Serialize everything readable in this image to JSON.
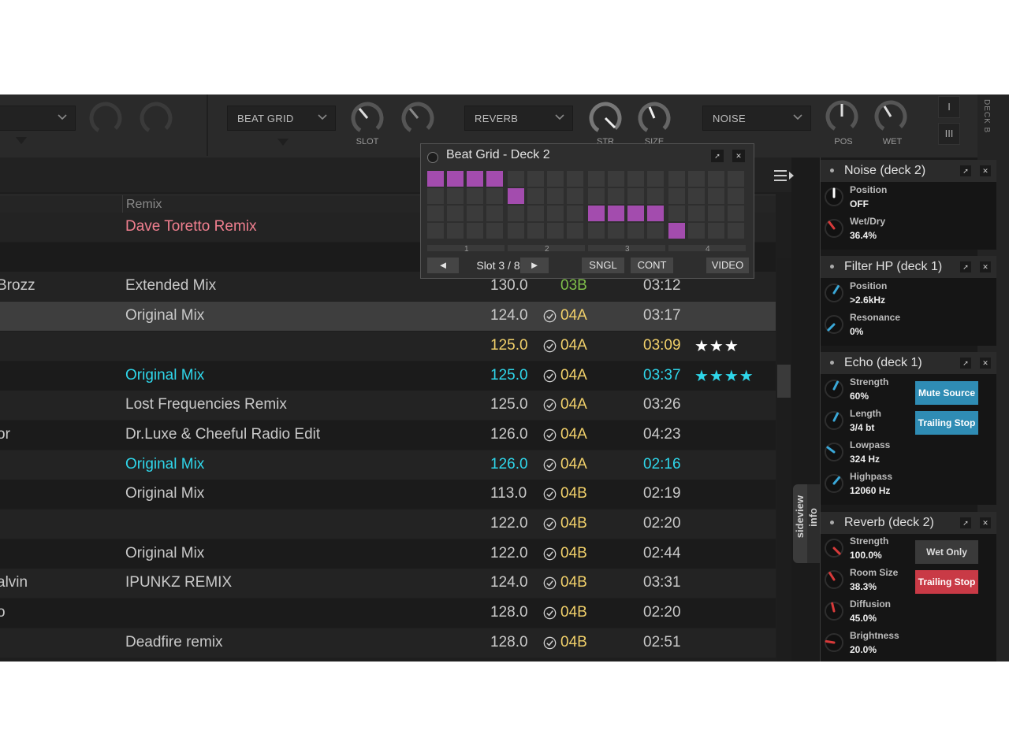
{
  "fxbar": {
    "slots": [
      {
        "name": ""
      },
      {
        "name": "BEAT GRID",
        "knob_labels": [
          "SLOT",
          ""
        ]
      },
      {
        "name": "REVERB",
        "knob_labels": [
          "STR",
          "SIZE"
        ]
      },
      {
        "name": "NOISE",
        "knob_labels": [
          "POS",
          "WET"
        ]
      }
    ],
    "side_buttons": [
      "I",
      "III"
    ],
    "deck_label": "DECK B"
  },
  "browser": {
    "column_header": "Remix",
    "rows": [
      {
        "artist": "",
        "remix": "Dave Toretto Remix",
        "bpm": "",
        "key": "",
        "length": "",
        "stars": "",
        "style": "pink"
      },
      {
        "artist": "",
        "remix": "",
        "bpm": "",
        "key": "",
        "length": "",
        "stars": "",
        "style": "normal"
      },
      {
        "artist": "Brozz",
        "remix": "Extended Mix",
        "bpm": "130.0",
        "key": "03B",
        "length": "03:12",
        "stars": "",
        "style": "normal",
        "check": false,
        "keycolor": "green"
      },
      {
        "artist": "",
        "remix": "Original Mix",
        "bpm": "124.0",
        "key": "04A",
        "length": "03:17",
        "stars": "",
        "style": "selected",
        "check": true,
        "keycolor": "yellow"
      },
      {
        "artist": "",
        "remix": "",
        "bpm": "125.0",
        "key": "04A",
        "length": "03:09",
        "stars": "★★★",
        "style": "yellow",
        "check": true,
        "keycolor": "yellow"
      },
      {
        "artist": "",
        "remix": "Original Mix",
        "bpm": "125.0",
        "key": "04A",
        "length": "03:37",
        "stars": "★★★★",
        "style": "cyan",
        "check": true,
        "keycolor": "yellow"
      },
      {
        "artist": "",
        "remix": "Lost Frequencies Remix",
        "bpm": "125.0",
        "key": "04A",
        "length": "03:26",
        "stars": "",
        "style": "normal",
        "check": true,
        "keycolor": "yellow"
      },
      {
        "artist": "or",
        "remix": "Dr.Luxe & Cheeful Radio Edit",
        "bpm": "126.0",
        "key": "04A",
        "length": "04:23",
        "stars": "",
        "style": "normal",
        "check": true,
        "keycolor": "yellow"
      },
      {
        "artist": "",
        "remix": "Original Mix",
        "bpm": "126.0",
        "key": "04A",
        "length": "02:16",
        "stars": "",
        "style": "cyan",
        "check": true,
        "keycolor": "yellow"
      },
      {
        "artist": "",
        "remix": "Original Mix",
        "bpm": "113.0",
        "key": "04B",
        "length": "02:19",
        "stars": "",
        "style": "normal",
        "check": true,
        "keycolor": "yellow"
      },
      {
        "artist": "",
        "remix": "",
        "bpm": "122.0",
        "key": "04B",
        "length": "02:20",
        "stars": "",
        "style": "normal",
        "check": true,
        "keycolor": "yellow"
      },
      {
        "artist": "",
        "remix": "Original Mix",
        "bpm": "122.0",
        "key": "04B",
        "length": "02:44",
        "stars": "",
        "style": "normal",
        "check": true,
        "keycolor": "yellow"
      },
      {
        "artist": "alvin",
        "remix": "IPUNKZ REMIX",
        "bpm": "124.0",
        "key": "04B",
        "length": "03:31",
        "stars": "",
        "style": "normal",
        "check": true,
        "keycolor": "yellow"
      },
      {
        "artist": "o",
        "remix": "",
        "bpm": "128.0",
        "key": "04B",
        "length": "02:20",
        "stars": "",
        "style": "normal",
        "check": true,
        "keycolor": "yellow"
      },
      {
        "artist": "",
        "remix": "Deadfire remix",
        "bpm": "128.0",
        "key": "04B",
        "length": "02:51",
        "stars": "",
        "style": "normal",
        "check": true,
        "keycolor": "yellow"
      }
    ]
  },
  "sidetab": {
    "tab1": "sideview",
    "tab2": "info"
  },
  "beatgrid": {
    "title": "Beat Grid - Deck 2",
    "slot_label": "Slot 3 / 8",
    "prev": "◄",
    "next": "►",
    "buttons": [
      "SNGL",
      "CONT",
      "VIDEO"
    ],
    "beat_numbers": [
      "1",
      "2",
      "3",
      "4"
    ],
    "active_steps": [
      {
        "beat": 1,
        "step": 0,
        "row": 0
      },
      {
        "beat": 1,
        "step": 1,
        "row": 0
      },
      {
        "beat": 1,
        "step": 2,
        "row": 0
      },
      {
        "beat": 1,
        "step": 3,
        "row": 0
      },
      {
        "beat": 2,
        "step": 0,
        "row": 1
      },
      {
        "beat": 3,
        "step": 0,
        "row": 2
      },
      {
        "beat": 3,
        "step": 1,
        "row": 2
      },
      {
        "beat": 3,
        "step": 2,
        "row": 2
      },
      {
        "beat": 3,
        "step": 3,
        "row": 2
      },
      {
        "beat": 4,
        "step": 0,
        "row": 3
      }
    ],
    "rows": 4,
    "steps_per_beat": 4,
    "accent_color": "#a34cae"
  },
  "effects": [
    {
      "title": "Noise (deck 2)",
      "params": [
        {
          "name": "Position",
          "value": "OFF",
          "level": 0.5,
          "color": "#ffffff"
        },
        {
          "name": "Wet/Dry",
          "value": "36.4%",
          "level": 0.36,
          "color": "#d83a3a"
        }
      ],
      "buttons": []
    },
    {
      "title": "Filter HP (deck 1)",
      "params": [
        {
          "name": "Position",
          "value": ">2.6kHz",
          "level": 0.62,
          "color": "#3aa8d8"
        },
        {
          "name": "Resonance",
          "value": "0%",
          "level": 0.0,
          "color": "#3aa8d8"
        }
      ],
      "buttons": []
    },
    {
      "title": "Echo (deck 1)",
      "params": [
        {
          "name": "Strength",
          "value": "60%",
          "level": 0.6,
          "color": "#3aa8d8"
        },
        {
          "name": "Length",
          "value": "3/4 bt",
          "level": 0.6,
          "color": "#3aa8d8"
        },
        {
          "name": "Lowpass",
          "value": "324 Hz",
          "level": 0.3,
          "color": "#3aa8d8"
        },
        {
          "name": "Highpass",
          "value": "12060 Hz",
          "level": 0.65,
          "color": "#3aa8d8"
        }
      ],
      "buttons": [
        {
          "label": "Mute Source",
          "style": "blue"
        },
        {
          "label": "Trailing Stop",
          "style": "blue"
        }
      ]
    },
    {
      "title": "Reverb (deck 2)",
      "params": [
        {
          "name": "Strength",
          "value": "100.0%",
          "level": 1.0,
          "color": "#d83a3a"
        },
        {
          "name": "Room Size",
          "value": "38.3%",
          "level": 0.38,
          "color": "#d83a3a"
        },
        {
          "name": "Diffusion",
          "value": "45.0%",
          "level": 0.45,
          "color": "#d83a3a"
        },
        {
          "name": "Brightness",
          "value": "20.0%",
          "level": 0.2,
          "color": "#d83a3a"
        }
      ],
      "buttons": [
        {
          "label": "Wet Only",
          "style": "grey"
        },
        {
          "label": "Trailing Stop",
          "style": "red"
        }
      ]
    }
  ],
  "colors": {
    "pink": "#f07f8f",
    "cyan": "#2fd6ea",
    "yellow": "#f1d06a",
    "green": "#7fbf4a",
    "text": "#c9c9c9",
    "star_white": "#ffffff",
    "star_cyan": "#2fd6ea"
  }
}
